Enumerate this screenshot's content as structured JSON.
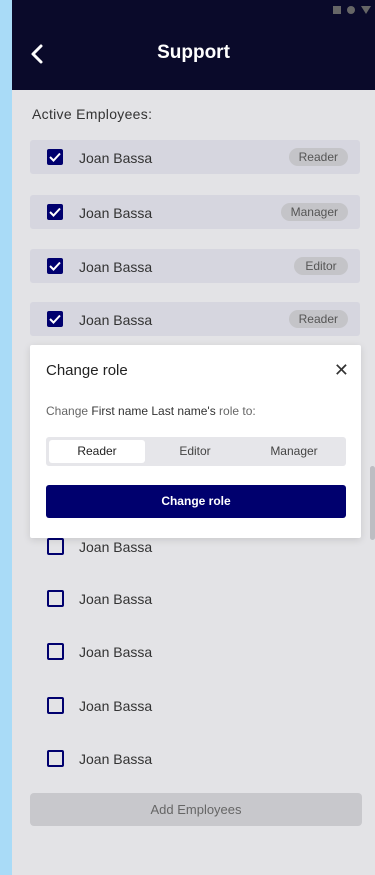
{
  "header": {
    "title": "Support",
    "back_icon": "chevron-left-icon",
    "background": "#0a0a2a"
  },
  "status_bar": {
    "icons": [
      "square-icon",
      "circle-icon",
      "triangle-down-icon"
    ]
  },
  "section_label": "Active Employees:",
  "active_employees": [
    {
      "name": "Joan Bassa",
      "role": "Reader",
      "checked": true
    },
    {
      "name": "Joan Bassa",
      "role": "Manager",
      "checked": true
    },
    {
      "name": "Joan Bassa",
      "role": "Editor",
      "checked": true
    },
    {
      "name": "Joan Bassa",
      "role": "Reader",
      "checked": true
    }
  ],
  "other_employees": [
    {
      "name": "Joan Bassa",
      "checked": false
    },
    {
      "name": "Joan Bassa",
      "checked": false
    },
    {
      "name": "Joan Bassa",
      "checked": false
    },
    {
      "name": "Joan Bassa",
      "checked": false
    },
    {
      "name": "Joan Bassa",
      "checked": false
    }
  ],
  "modal": {
    "title": "Change role",
    "text_prefix": "Change ",
    "text_name": "First name Last name's",
    "text_suffix": " role to:",
    "options": [
      "Reader",
      "Editor",
      "Manager"
    ],
    "selected": "Reader",
    "button_label": "Change role"
  },
  "add_button_label": "Add Employees",
  "colors": {
    "accent": "#00006e",
    "page_bg": "#e3e3e6",
    "outer_bg": "#a9dbf7"
  }
}
